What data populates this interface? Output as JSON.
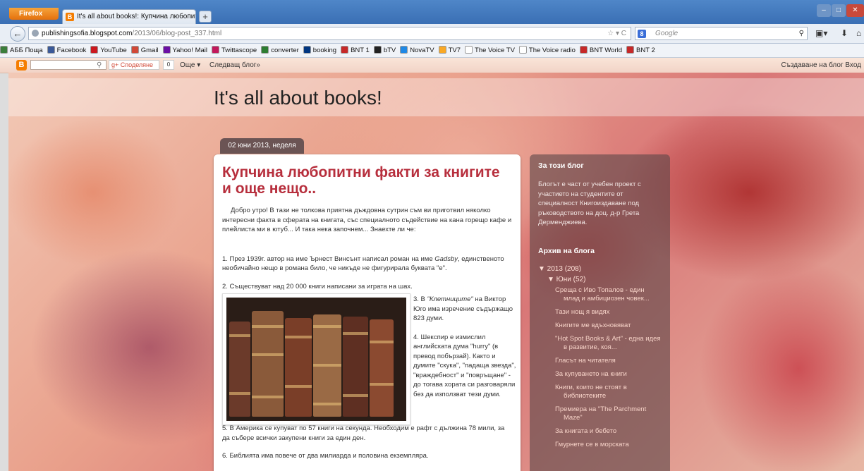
{
  "browser": {
    "menu_label": "Firefox",
    "tab_title": "It's all about books!: Купчина любопит...",
    "newtab": "+",
    "url_host": "publishingsofia.blogspot.com",
    "url_path": "/2013/06/blog-post_337.html",
    "search_placeholder": "Google",
    "bookmarks": [
      {
        "label": "АББ Поща",
        "color": "#3b7d3b"
      },
      {
        "label": "Facebook",
        "color": "#3b5998"
      },
      {
        "label": "YouTube",
        "color": "#cc181e"
      },
      {
        "label": "Gmail",
        "color": "#d14836"
      },
      {
        "label": "Yahoo! Mail",
        "color": "#6b0fa5"
      },
      {
        "label": "Twittascope",
        "color": "#c2185b"
      },
      {
        "label": "converter",
        "color": "#2e7d32"
      },
      {
        "label": "booking",
        "color": "#003580"
      },
      {
        "label": "BNT 1",
        "color": "#c62828"
      },
      {
        "label": "bTV",
        "color": "#222222"
      },
      {
        "label": "NovaTV",
        "color": "#1e88e5"
      },
      {
        "label": "TV7",
        "color": "#f9a825"
      },
      {
        "label": "The Voice TV",
        "color": "#ffffff"
      },
      {
        "label": "The Voice radio",
        "color": "#ffffff"
      },
      {
        "label": "BNT World",
        "color": "#c62828"
      },
      {
        "label": "BNT 2",
        "color": "#c62828"
      }
    ]
  },
  "bloggerbar": {
    "logo": "B",
    "share_label": "Споделяне",
    "share_count": "0",
    "more_label": "Още ▾",
    "next_blog": "Следващ блог»",
    "right_links": "Създаване на блог  Вход"
  },
  "blog": {
    "title": "It's all about books!",
    "date": "02 юни 2013, неделя"
  },
  "post": {
    "title": "Купчина любопитни факти за книгите и още нещо..",
    "intro": "Добро утро! В тази не толкова приятна дъждовна сутрин съм ви приготвил няколко интересни факта в сферата на книгата, със специалното съдействие на кана горещо кафе и плейлиста ми в ютуб... И така нека започнем... Знаехте ли че:",
    "fact1_a": "1. През 1939г. автор на име Ърнест Винсънт написал роман на име ",
    "fact1_em": "Gadsby",
    "fact1_b": ", единственото необичайно нещо в романа било, че никъде не фигурирала буквата \"е\".",
    "fact2": "2. Съществуват над 20 000 книги написани за играта на шах.",
    "fact3_a": "3. В ",
    "fact3_em": "\"Клетниците\"",
    "fact3_b": " на Виктор Юго има изречение съдържащо 823 думи.",
    "fact4": "4. Шекспир е измислил английската дума \"hurry\" (в превод побързай). Както и думите \"скука\", \"падаща звезда\", \"враждебност\" и \"повръщане\" - до тогава хората си разговаряли без да използват тези думи.",
    "fact5": "5. В Америка се купуват по 57 книги на секунда. Необходим е рафт с дължина 78 мили, за да събере всички закупени книги за един ден.",
    "fact6": "6. Библията има повече от два милиарда и половина екземпляра."
  },
  "sidebar": {
    "about_heading": "За този блог",
    "about_text": "Блогът е част от учебен проект с участието на студентите от специалност Книгоиздаване под ръководството на доц. д-р Грета Дерменджиева.",
    "archive_heading": "Архив на блога",
    "year": "▼ 2013 (208)",
    "month": "▼ Юни (52)",
    "posts": [
      "Среща с Иво Топалов - един млад и амбициозен човек...",
      "Тази нощ я видях",
      "Книгите ме вдъхновяват",
      "\"Hot Spot Books & Art\" - една идея в развитие, коя...",
      "Гласът на читателя",
      "За купуването на книги",
      "Книги, които не стоят в библиотеките",
      "Премиера на \"The Parchment Maze\"",
      "За книгата и бебето",
      "Гмурнете се в морската"
    ]
  }
}
